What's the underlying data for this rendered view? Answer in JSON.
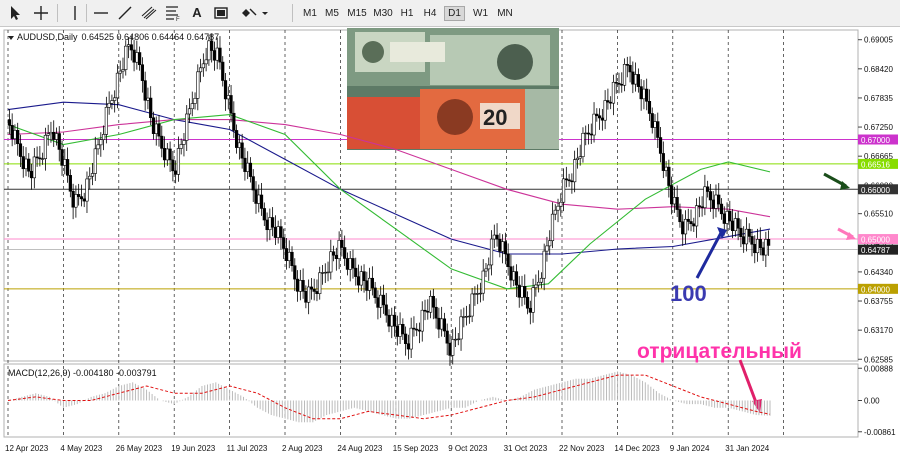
{
  "toolbar": {
    "tools": [
      "cursor-icon",
      "crosshair-icon",
      "vertical-line-icon",
      "horizontal-line-icon",
      "trendline-icon",
      "channel-icon",
      "fibonacci-icon",
      "text-tool-icon",
      "label-tool-icon",
      "shapes-icon"
    ],
    "text_tool_label": "A",
    "timeframes": [
      "M1",
      "M5",
      "M15",
      "M30",
      "H1",
      "H4",
      "D1",
      "W1",
      "MN"
    ],
    "active_timeframe": "D1"
  },
  "chart_data": {
    "type": "line",
    "title": "AUDUSD,Daily",
    "ohlc_values": "0.64525 0.64806 0.64464 0.64787",
    "price_ticks": [
      "0.69005",
      "0.68420",
      "0.67835",
      "0.67250",
      "0.66665",
      "0.66080",
      "0.65510",
      "0.64925",
      "0.64340",
      "0.63755",
      "0.63170",
      "0.62585"
    ],
    "price_range": [
      0.6255,
      0.692
    ],
    "date_ticks": [
      "12 Apr 2023",
      "4 May 2023",
      "26 May 2023",
      "19 Jun 2023",
      "11 Jul 2023",
      "2 Aug 2023",
      "24 Aug 2023",
      "15 Sep 2023",
      "9 Oct 2023",
      "31 Oct 2023",
      "22 Nov 2023",
      "14 Dec 2023",
      "9 Jan 2024",
      "31 Jan 2024"
    ],
    "price_path": [
      [
        0,
        0.674
      ],
      [
        8,
        0.668
      ],
      [
        16,
        0.663
      ],
      [
        24,
        0.667
      ],
      [
        32,
        0.673
      ],
      [
        40,
        0.665
      ],
      [
        48,
        0.657
      ],
      [
        56,
        0.66
      ],
      [
        64,
        0.667
      ],
      [
        72,
        0.676
      ],
      [
        80,
        0.683
      ],
      [
        88,
        0.689
      ],
      [
        96,
        0.684
      ],
      [
        104,
        0.673
      ],
      [
        112,
        0.668
      ],
      [
        120,
        0.664
      ],
      [
        128,
        0.672
      ],
      [
        136,
        0.681
      ],
      [
        144,
        0.689
      ],
      [
        152,
        0.686
      ],
      [
        160,
        0.676
      ],
      [
        168,
        0.667
      ],
      [
        176,
        0.661
      ],
      [
        184,
        0.655
      ],
      [
        192,
        0.652
      ],
      [
        200,
        0.648
      ],
      [
        208,
        0.642
      ],
      [
        216,
        0.638
      ],
      [
        224,
        0.641
      ],
      [
        232,
        0.646
      ],
      [
        240,
        0.648
      ],
      [
        248,
        0.644
      ],
      [
        256,
        0.642
      ],
      [
        264,
        0.639
      ],
      [
        272,
        0.636
      ],
      [
        280,
        0.632
      ],
      [
        288,
        0.629
      ],
      [
        296,
        0.633
      ],
      [
        304,
        0.637
      ],
      [
        312,
        0.633
      ],
      [
        320,
        0.628
      ],
      [
        328,
        0.633
      ],
      [
        336,
        0.638
      ],
      [
        344,
        0.643
      ],
      [
        352,
        0.651
      ],
      [
        360,
        0.646
      ],
      [
        368,
        0.64
      ],
      [
        376,
        0.636
      ],
      [
        384,
        0.643
      ],
      [
        392,
        0.652
      ],
      [
        400,
        0.66
      ],
      [
        408,
        0.664
      ],
      [
        416,
        0.67
      ],
      [
        424,
        0.674
      ],
      [
        432,
        0.677
      ],
      [
        440,
        0.681
      ],
      [
        448,
        0.685
      ],
      [
        456,
        0.68
      ],
      [
        464,
        0.675
      ],
      [
        472,
        0.667
      ],
      [
        480,
        0.657
      ],
      [
        488,
        0.652
      ],
      [
        496,
        0.655
      ],
      [
        504,
        0.659
      ],
      [
        512,
        0.657
      ],
      [
        520,
        0.654
      ],
      [
        528,
        0.651
      ],
      [
        536,
        0.65
      ],
      [
        544,
        0.648
      ],
      [
        550,
        0.6479
      ]
    ],
    "ma_series": [
      {
        "color": "#1a1a8c",
        "points": [
          [
            0,
            0.676
          ],
          [
            40,
            0.6775
          ],
          [
            80,
            0.677
          ],
          [
            120,
            0.674
          ],
          [
            160,
            0.672
          ],
          [
            200,
            0.666
          ],
          [
            240,
            0.66
          ],
          [
            280,
            0.655
          ],
          [
            320,
            0.65
          ],
          [
            360,
            0.647
          ],
          [
            400,
            0.647
          ],
          [
            440,
            0.648
          ],
          [
            480,
            0.6485
          ],
          [
            520,
            0.6505
          ],
          [
            550,
            0.652
          ]
        ]
      },
      {
        "color": "#cc3399",
        "points": [
          [
            0,
            0.671
          ],
          [
            40,
            0.6715
          ],
          [
            80,
            0.673
          ],
          [
            120,
            0.674
          ],
          [
            160,
            0.674
          ],
          [
            200,
            0.673
          ],
          [
            240,
            0.671
          ],
          [
            280,
            0.668
          ],
          [
            320,
            0.664
          ],
          [
            360,
            0.66
          ],
          [
            400,
            0.657
          ],
          [
            440,
            0.656
          ],
          [
            480,
            0.6565
          ],
          [
            520,
            0.656
          ],
          [
            550,
            0.6545
          ]
        ]
      },
      {
        "color": "#33bb33",
        "points": [
          [
            0,
            0.673
          ],
          [
            40,
            0.669
          ],
          [
            80,
            0.671
          ],
          [
            120,
            0.674
          ],
          [
            160,
            0.675
          ],
          [
            200,
            0.671
          ],
          [
            240,
            0.66
          ],
          [
            280,
            0.652
          ],
          [
            320,
            0.644
          ],
          [
            360,
            0.64
          ],
          [
            390,
            0.641
          ],
          [
            420,
            0.649
          ],
          [
            460,
            0.658
          ],
          [
            500,
            0.664
          ],
          [
            520,
            0.6655
          ],
          [
            550,
            0.6635
          ]
        ]
      }
    ],
    "levels": [
      {
        "value": 0.67,
        "label": "0.67000",
        "color": "#cc33cc"
      },
      {
        "value": 0.6651,
        "label": "0.66516",
        "color": "#88dd00"
      },
      {
        "value": 0.66,
        "label": "0.66000",
        "color": "#333333"
      },
      {
        "value": 0.65,
        "label": "0.65000",
        "color": "#ff88cc"
      },
      {
        "value": 0.64,
        "label": "0.64000",
        "color": "#bba000"
      }
    ],
    "current_price": {
      "value": 0.64787,
      "label": "0.64787"
    },
    "annotations": {
      "ma_label": "100",
      "macd_word": "отрицательный"
    },
    "macd": {
      "label": "MACD(12,26,9) -0.004180 -0.003791",
      "ticks": [
        "0.00888",
        "0.00",
        "-0.00861"
      ],
      "range": [
        -0.0095,
        0.0095
      ],
      "hist": [
        [
          0,
          0.0
        ],
        [
          10,
          0.001
        ],
        [
          20,
          0.002
        ],
        [
          30,
          0.001
        ],
        [
          40,
          -0.002
        ],
        [
          50,
          -0.001
        ],
        [
          60,
          0.001
        ],
        [
          70,
          0.002
        ],
        [
          80,
          0.004
        ],
        [
          90,
          0.005
        ],
        [
          100,
          0.003
        ],
        [
          110,
          0.0
        ],
        [
          120,
          -0.001
        ],
        [
          130,
          0.001
        ],
        [
          140,
          0.004
        ],
        [
          150,
          0.005
        ],
        [
          160,
          0.003
        ],
        [
          170,
          0.001
        ],
        [
          180,
          -0.002
        ],
        [
          190,
          -0.004
        ],
        [
          200,
          -0.005
        ],
        [
          210,
          -0.006
        ],
        [
          220,
          -0.006
        ],
        [
          230,
          -0.004
        ],
        [
          240,
          -0.003
        ],
        [
          250,
          -0.002
        ],
        [
          260,
          -0.003
        ],
        [
          270,
          -0.004
        ],
        [
          280,
          -0.005
        ],
        [
          290,
          -0.005
        ],
        [
          300,
          -0.004
        ],
        [
          310,
          -0.003
        ],
        [
          320,
          -0.002
        ],
        [
          330,
          -0.002
        ],
        [
          340,
          0.0
        ],
        [
          350,
          0.001
        ],
        [
          360,
          0.0
        ],
        [
          370,
          0.001
        ],
        [
          380,
          0.003
        ],
        [
          390,
          0.004
        ],
        [
          400,
          0.005
        ],
        [
          410,
          0.006
        ],
        [
          420,
          0.006
        ],
        [
          430,
          0.007
        ],
        [
          440,
          0.008
        ],
        [
          450,
          0.007
        ],
        [
          460,
          0.005
        ],
        [
          470,
          0.002
        ],
        [
          480,
          0.0
        ],
        [
          490,
          -0.001
        ],
        [
          500,
          -0.001
        ],
        [
          510,
          -0.002
        ],
        [
          520,
          -0.002
        ],
        [
          530,
          -0.003
        ],
        [
          540,
          -0.004
        ],
        [
          550,
          -0.0042
        ]
      ],
      "signal": [
        [
          0,
          0.0
        ],
        [
          20,
          0.001
        ],
        [
          40,
          0.0
        ],
        [
          60,
          0.0
        ],
        [
          80,
          0.002
        ],
        [
          100,
          0.004
        ],
        [
          120,
          0.002
        ],
        [
          140,
          0.002
        ],
        [
          160,
          0.004
        ],
        [
          180,
          0.002
        ],
        [
          200,
          -0.002
        ],
        [
          220,
          -0.005
        ],
        [
          240,
          -0.005
        ],
        [
          260,
          -0.003
        ],
        [
          280,
          -0.004
        ],
        [
          300,
          -0.005
        ],
        [
          320,
          -0.004
        ],
        [
          340,
          -0.002
        ],
        [
          360,
          0.0
        ],
        [
          380,
          0.001
        ],
        [
          400,
          0.003
        ],
        [
          420,
          0.005
        ],
        [
          440,
          0.007
        ],
        [
          460,
          0.007
        ],
        [
          480,
          0.004
        ],
        [
          500,
          0.001
        ],
        [
          520,
          -0.001
        ],
        [
          540,
          -0.003
        ],
        [
          550,
          -0.0038
        ]
      ]
    }
  }
}
